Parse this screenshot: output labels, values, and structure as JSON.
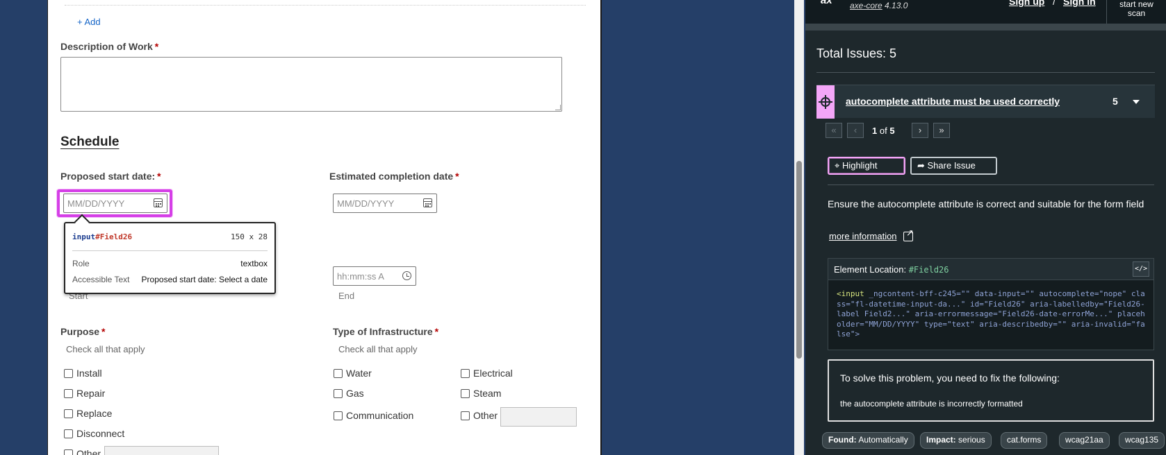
{
  "form": {
    "add_link": "+ Add",
    "description_label": "Description of Work",
    "required_mark": "*",
    "schedule_title": "Schedule",
    "start_date_label": "Proposed start date:",
    "completion_date_label": "Estimated completion date",
    "date_placeholder": "MM/DD/YYYY",
    "time_placeholder": "hh:mm:ss A",
    "start_caption": "Start",
    "end_caption": "End",
    "purpose_label": "Purpose",
    "purpose_hint": "Check all that apply",
    "purpose_options": [
      "Install",
      "Repair",
      "Replace",
      "Disconnect",
      "Other"
    ],
    "infra_label": "Type of Infrastructure",
    "infra_hint": "Check all that apply",
    "infra_col1": [
      "Water",
      "Gas",
      "Communication"
    ],
    "infra_col2": [
      "Electrical",
      "Steam",
      "Other"
    ]
  },
  "tooltip": {
    "tag": "input",
    "id": "#Field26",
    "dims": "150 x 28",
    "role_label": "Role",
    "role_value": "textbox",
    "name_label": "Accessible Text",
    "name_value": "Proposed start date: Select a date"
  },
  "axe": {
    "logo": "ax",
    "product": "axe-core",
    "version": "4.13.0",
    "sign_up": "Sign up",
    "separator": "/",
    "sign_in": "Sign in",
    "new_scan_line1": "start new",
    "new_scan_line2": "scan",
    "total_issues": "Total Issues: 5",
    "issue_title": "autocomplete attribute must be used correctly",
    "issue_count": "5",
    "pager_current": "1",
    "pager_of": "of",
    "pager_total": "5",
    "highlight_label": "Highlight",
    "share_label": "Share Issue",
    "rule_description": "Ensure the autocomplete attribute is correct and suitable for the form field",
    "more_info": "more information",
    "element_location_label": "Element Location:",
    "element_location_selector": "#Field26",
    "code_toggle": "</>",
    "code_tag": "<input",
    "code_rest": " _ngcontent-bff-c245=\"\" data-input=\"\" autocomplete=\"nope\" class=\"fl-datetime-input-da...\" id=\"Field26\" aria-labelledby=\"Field26-label Field2...\" aria-errormessage=\"Field26-date-errorMe...\" placeholder=\"MM/DD/YYYY\" type=\"text\" aria-describedby=\"\" aria-invalid=\"false\">",
    "fix_heading": "To solve this problem, you need to fix the following:",
    "fix_item": "the autocomplete attribute is incorrectly formatted",
    "tags": [
      {
        "key": "Found:",
        "value": "Automatically"
      },
      {
        "key": "Impact:",
        "value": "serious"
      },
      {
        "key": "",
        "value": "cat.forms"
      },
      {
        "key": "",
        "value": "wcag21aa"
      },
      {
        "key": "",
        "value": "wcag135"
      }
    ]
  },
  "colors": {
    "highlight": "#d53fe7",
    "panel_bg": "#1e282c",
    "issue_icon_bg": "#f4a6f8",
    "page_bg": "#253f68"
  }
}
